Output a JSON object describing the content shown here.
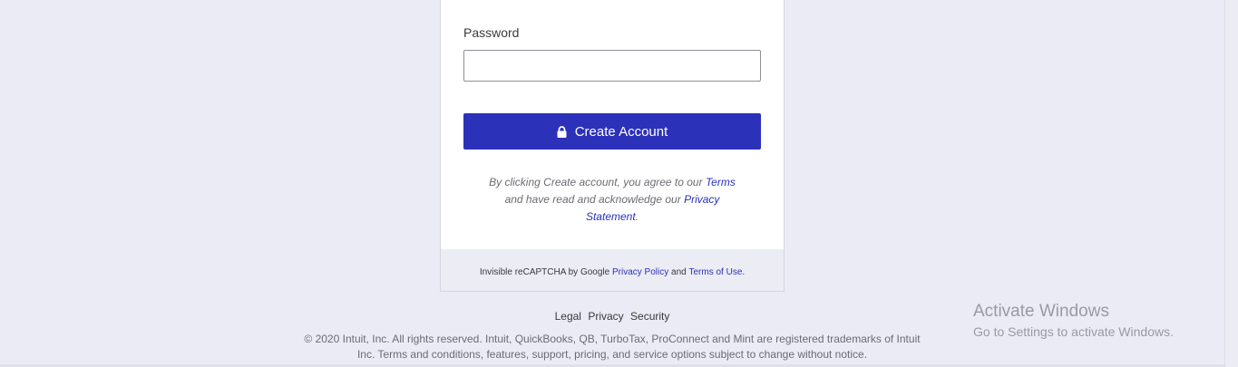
{
  "form": {
    "password_label": "Password",
    "password_value": "",
    "create_button_label": "Create Account",
    "agree_prefix": "By clicking Create account, you agree to our",
    "terms_link": "Terms",
    "agree_middle": "and have read and acknowledge our",
    "privacy_link": "Privacy Statement",
    "agree_suffix": "."
  },
  "recaptcha": {
    "prefix": "Invisible reCAPTCHA by Google",
    "privacy_link": "Privacy Policy",
    "and": "and",
    "terms_link": "Terms of Use",
    "suffix": "."
  },
  "footer": {
    "links": [
      "Legal",
      "Privacy",
      "Security"
    ],
    "copyright": "© 2020 Intuit, Inc. All rights reserved. Intuit, QuickBooks, QB, TurboTax, ProConnect and Mint are registered trademarks of Intuit Inc. Terms and conditions, features, support, pricing, and service options subject to change without notice."
  },
  "watermark": {
    "title": "Activate Windows",
    "subtitle": "Go to Settings to activate Windows."
  },
  "colors": {
    "primary_button": "#2b31b9",
    "page_background": "#ebebf5",
    "link": "#2b31b9"
  },
  "icons": {
    "button_icon": "lock-icon"
  }
}
